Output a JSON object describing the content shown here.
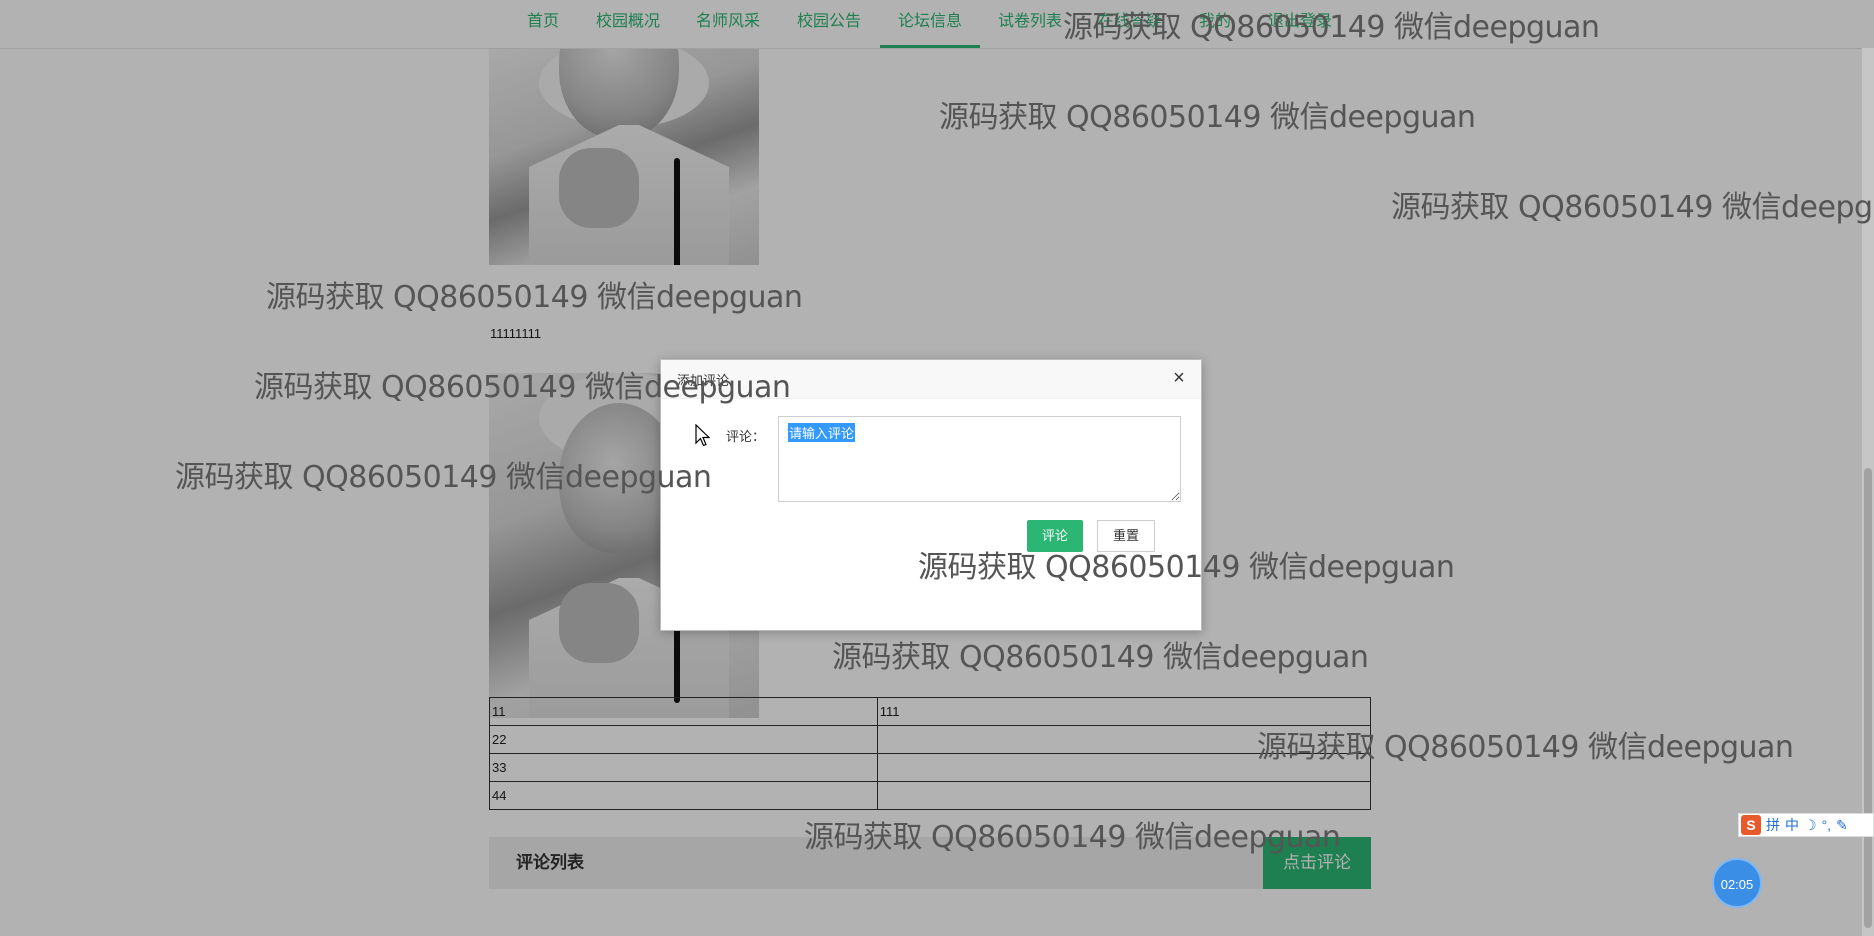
{
  "nav": {
    "items": [
      "首页",
      "校园概况",
      "名师风采",
      "校园公告",
      "论坛信息",
      "试卷列表",
      "在线答疑",
      "我的",
      "退出登录"
    ],
    "active_index": 4,
    "accent": "#2bb673"
  },
  "content": {
    "post_text": "11111111",
    "table_rows": [
      [
        "11",
        "111"
      ],
      [
        "22",
        ""
      ],
      [
        "33",
        ""
      ],
      [
        "44",
        ""
      ]
    ],
    "comments_title": "评论列表",
    "comment_button": "点击评论"
  },
  "modal": {
    "title": "添加评论",
    "label": "评论：",
    "placeholder": "请输入评论",
    "submit_label": "评论",
    "reset_label": "重置",
    "close_icon": "×"
  },
  "watermark": {
    "text": "源码获取 QQ86050149 微信deepguan"
  },
  "ime": {
    "badge": "S",
    "labels": [
      "拼",
      "中",
      "☽",
      "°,",
      "✎"
    ]
  },
  "timer": "02:05"
}
